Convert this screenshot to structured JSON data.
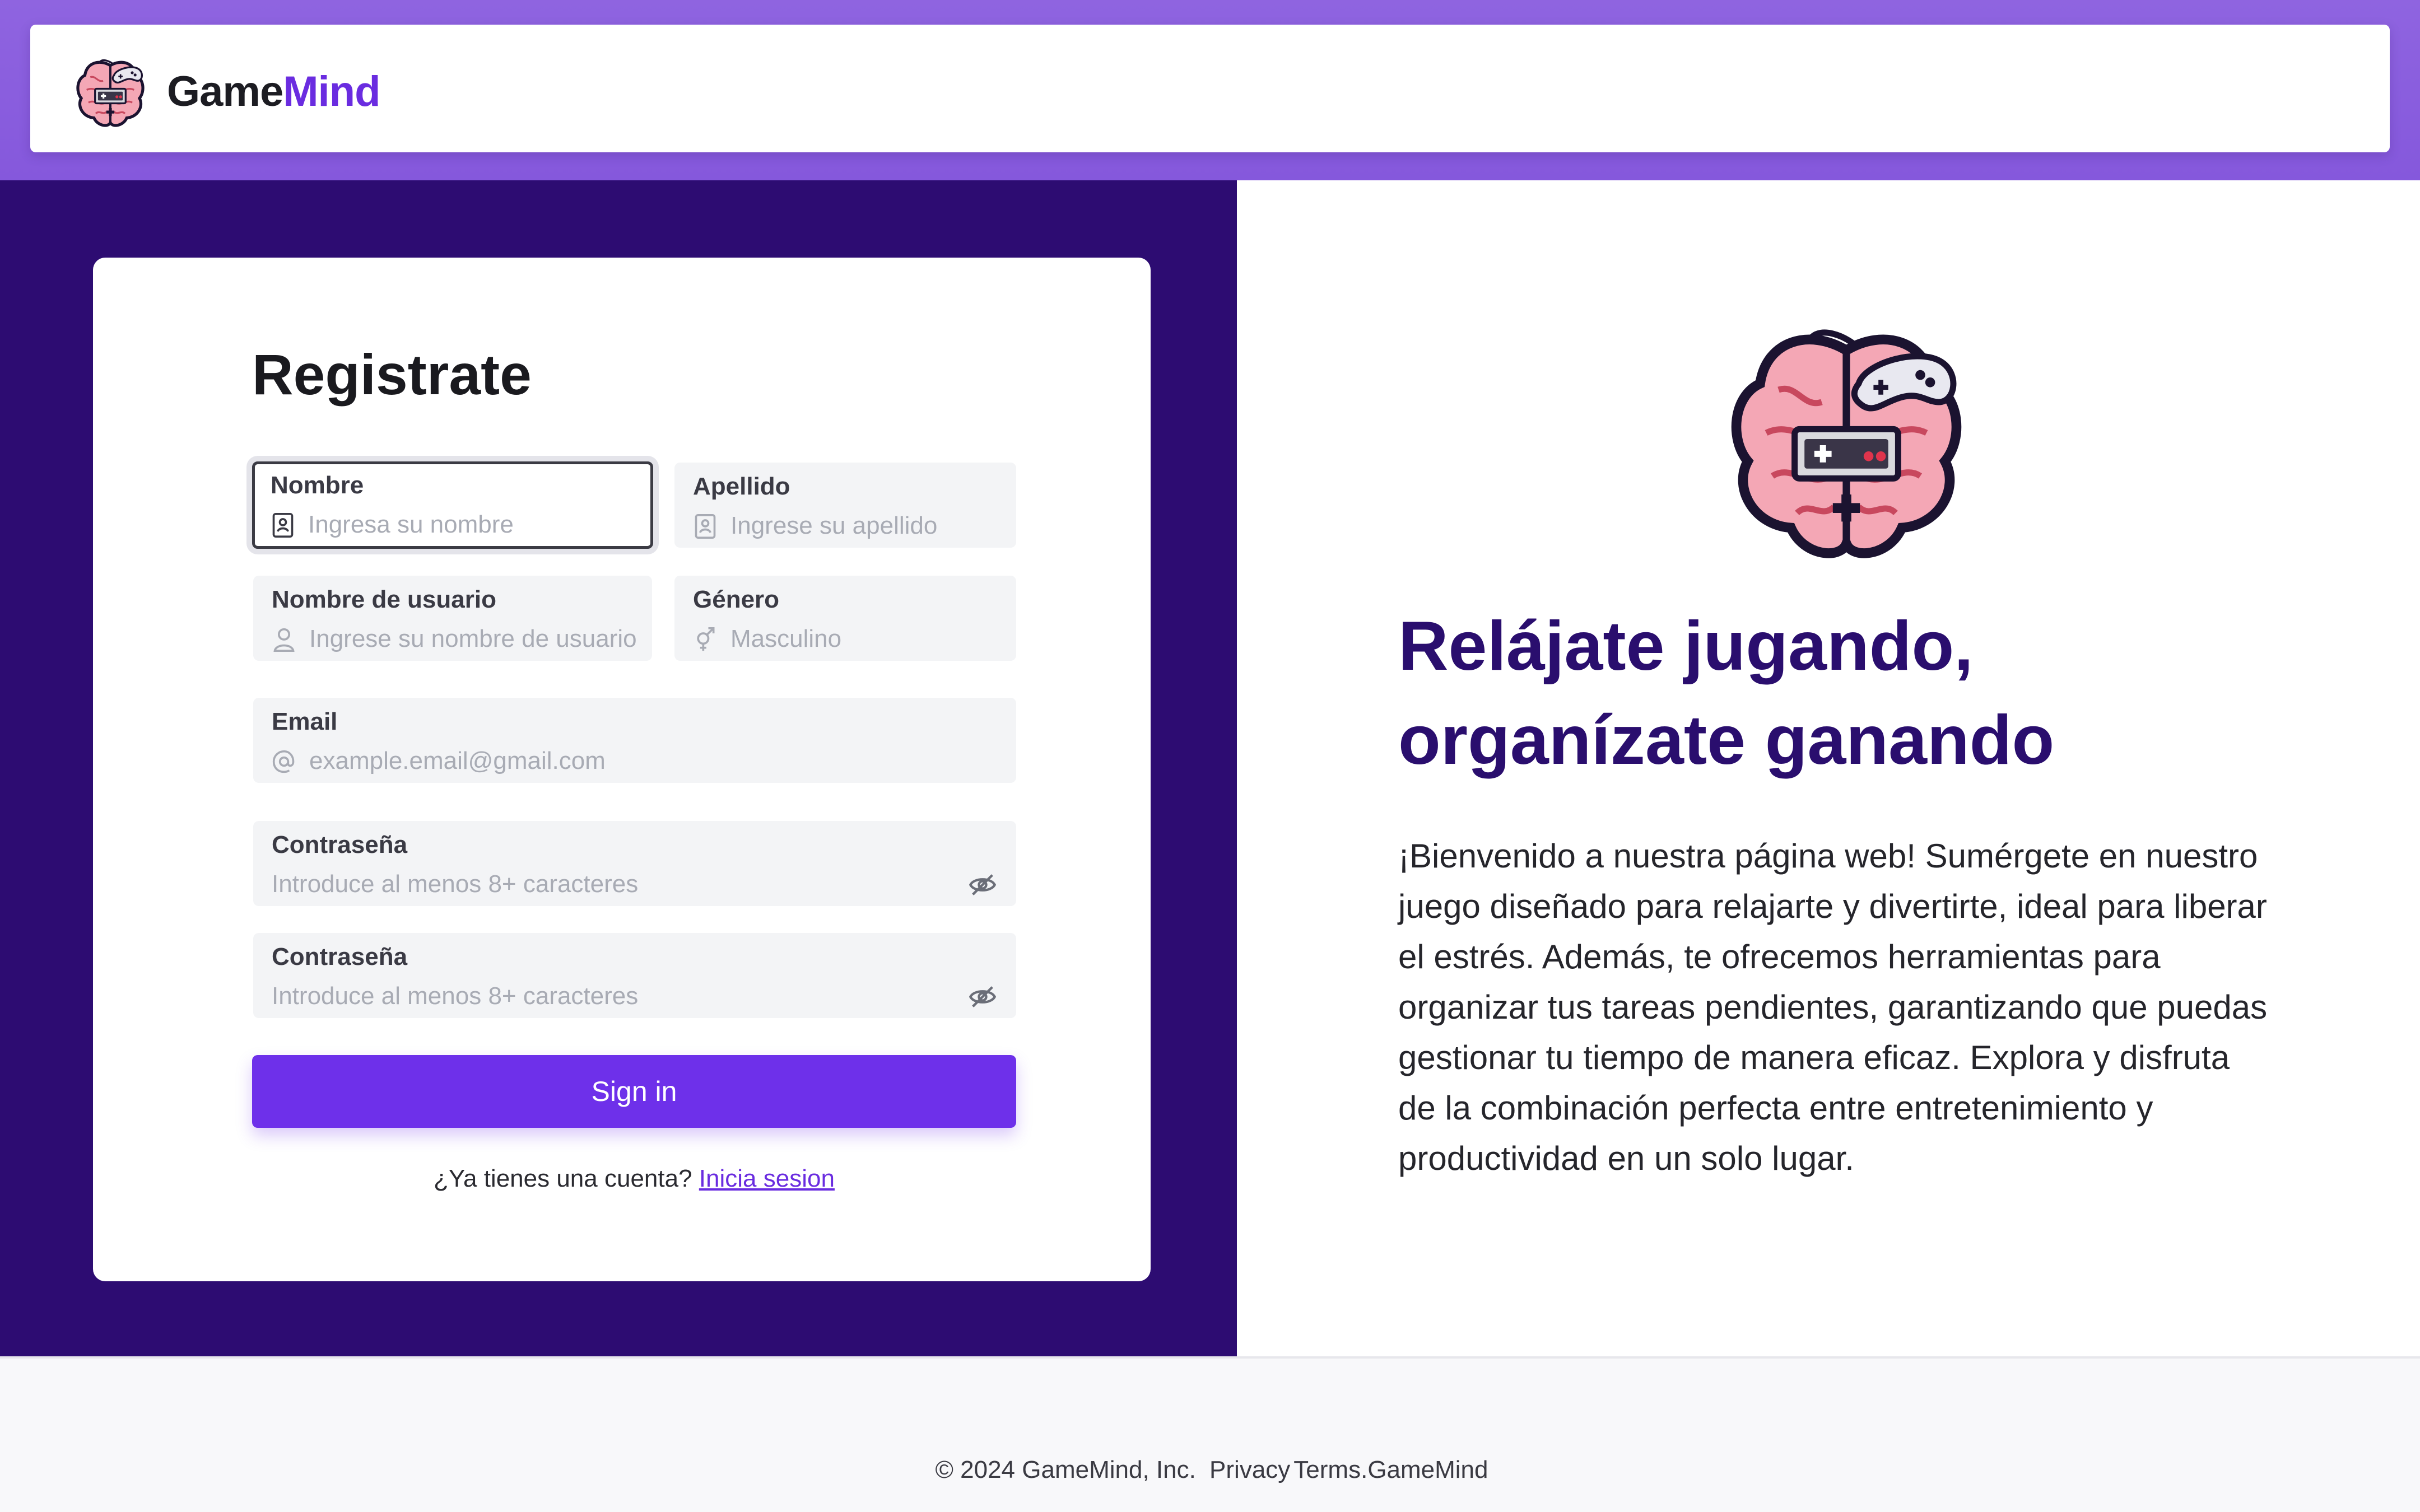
{
  "header": {
    "brand_part1": "Game",
    "brand_part2": "Mind",
    "logo_icon": "brain-gamepad-logo"
  },
  "form": {
    "title": "Registrate",
    "fields": {
      "first_name": {
        "label": "Nombre",
        "placeholder": "Ingresa su nombre",
        "icon": "id-card-icon"
      },
      "last_name": {
        "label": "Apellido",
        "placeholder": "Ingrese su apellido",
        "icon": "id-card-icon"
      },
      "username": {
        "label": "Nombre de usuario",
        "placeholder": "Ingrese su nombre de  usuario",
        "icon": "user-icon"
      },
      "gender": {
        "label": "Género",
        "placeholder": "Masculino",
        "icon": "gender-icon"
      },
      "email": {
        "label": "Email",
        "placeholder": "example.email@gmail.com",
        "icon": "at-icon"
      },
      "password": {
        "label": "Contraseña",
        "placeholder": "Introduce al menos 8+ caracteres",
        "icon": "eye-off-icon"
      },
      "password_confirm": {
        "label": "Contraseña",
        "placeholder": "Introduce al menos 8+ caracteres",
        "icon": "eye-off-icon"
      }
    },
    "submit_label": "Sign in",
    "login_prompt": "¿Ya tienes  una cuenta?",
    "login_link": "Inicia sesion"
  },
  "hero": {
    "headline_line1": "Relájate jugando,",
    "headline_line2": "organízate ganando",
    "paragraph": "¡Bienvenido a nuestra página web! Sumérgete en nuestro juego diseñado para relajarte y divertirte, ideal para liberar el estrés. Además, te ofrecemos herramientas para organizar tus tareas pendientes, garantizando que puedas gestionar tu tiempo de manera eficaz. Explora y disfruta de la combinación perfecta entre entretenimiento y productividad en un solo lugar.",
    "image_icon": "brain-gamepad-illustration"
  },
  "footer": {
    "copyright": "© 2024 GameMind, Inc.",
    "privacy": "Privacy",
    "terms": "Terms",
    "brand": "GameMind"
  },
  "colors": {
    "header_bg": "#8a5ede",
    "left_panel_bg": "#2d0c72",
    "accent": "#6e30ea",
    "headline": "#2a0e6e"
  }
}
